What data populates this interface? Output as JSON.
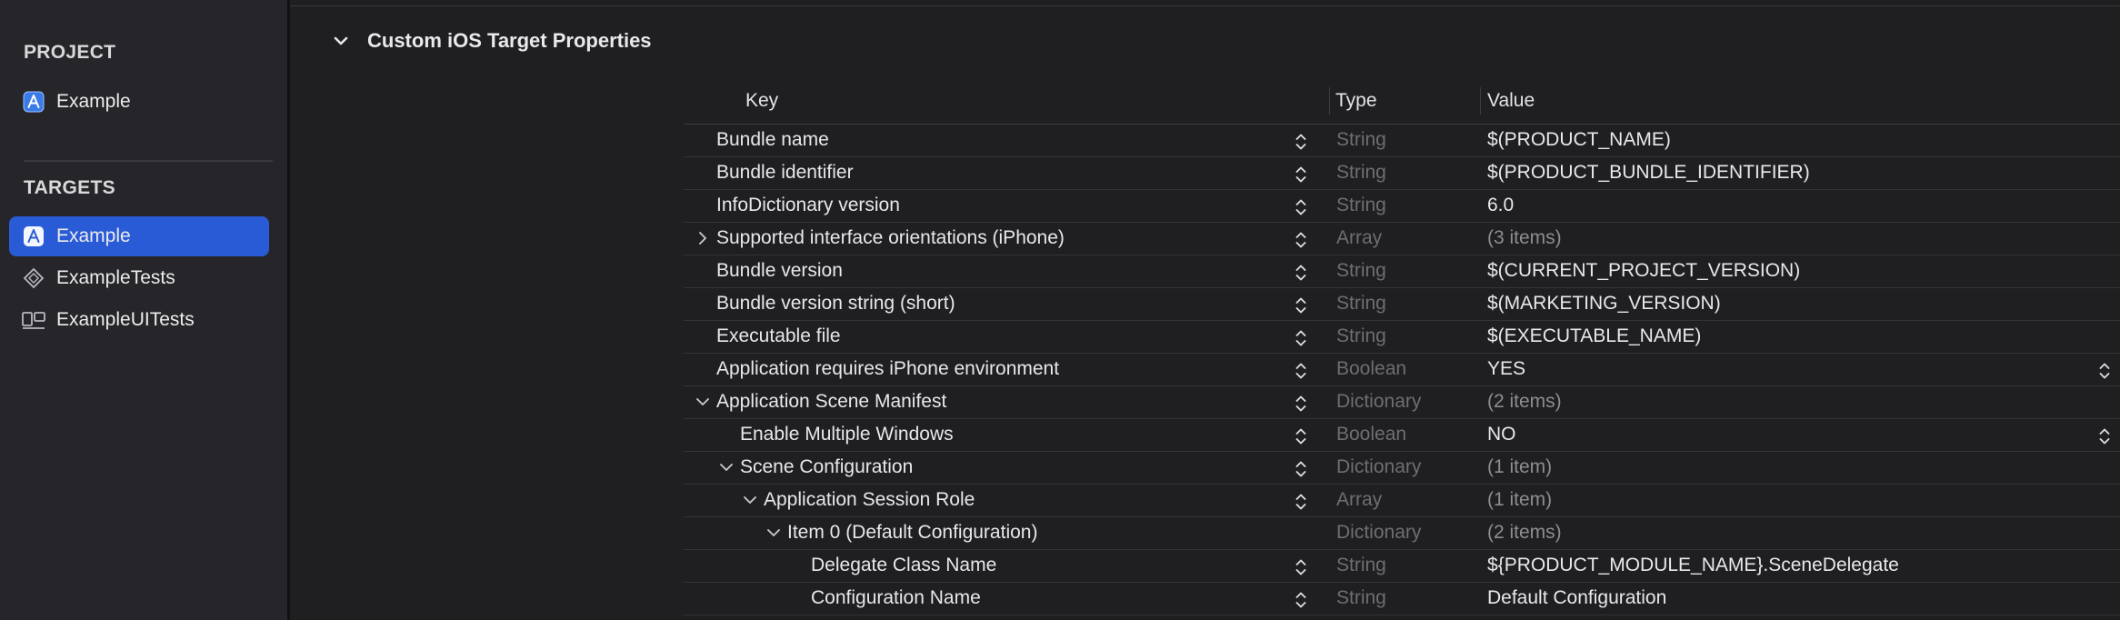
{
  "sidebar": {
    "project_title": "PROJECT",
    "project_items": [
      {
        "label": "Example",
        "icon": "app-target-icon"
      }
    ],
    "targets_title": "TARGETS",
    "target_items": [
      {
        "label": "Example",
        "icon": "app-target-icon",
        "selected": true
      },
      {
        "label": "ExampleTests",
        "icon": "unit-test-icon",
        "selected": false
      },
      {
        "label": "ExampleUITests",
        "icon": "ui-test-icon",
        "selected": false
      }
    ]
  },
  "section": {
    "title": "Custom iOS Target Properties",
    "expanded": true
  },
  "table": {
    "headers": {
      "key": "Key",
      "type": "Type",
      "value": "Value"
    },
    "rows": [
      {
        "key": "Bundle name",
        "type": "String",
        "value": "$(PRODUCT_NAME)",
        "level": 0,
        "disclosure": "none",
        "value_dim": false,
        "value_stepper": false
      },
      {
        "key": "Bundle identifier",
        "type": "String",
        "value": "$(PRODUCT_BUNDLE_IDENTIFIER)",
        "level": 0,
        "disclosure": "none",
        "value_dim": false,
        "value_stepper": false
      },
      {
        "key": "InfoDictionary version",
        "type": "String",
        "value": "6.0",
        "level": 0,
        "disclosure": "none",
        "value_dim": false,
        "value_stepper": false
      },
      {
        "key": "Supported interface orientations (iPhone)",
        "type": "Array",
        "value": "(3 items)",
        "level": 0,
        "disclosure": "collapsed",
        "value_dim": true,
        "value_stepper": false
      },
      {
        "key": "Bundle version",
        "type": "String",
        "value": "$(CURRENT_PROJECT_VERSION)",
        "level": 0,
        "disclosure": "none",
        "value_dim": false,
        "value_stepper": false
      },
      {
        "key": "Bundle version string (short)",
        "type": "String",
        "value": "$(MARKETING_VERSION)",
        "level": 0,
        "disclosure": "none",
        "value_dim": false,
        "value_stepper": false
      },
      {
        "key": "Executable file",
        "type": "String",
        "value": "$(EXECUTABLE_NAME)",
        "level": 0,
        "disclosure": "none",
        "value_dim": false,
        "value_stepper": false
      },
      {
        "key": "Application requires iPhone environment",
        "type": "Boolean",
        "value": "YES",
        "level": 0,
        "disclosure": "none",
        "value_dim": false,
        "value_stepper": true
      },
      {
        "key": "Application Scene Manifest",
        "type": "Dictionary",
        "value": "(2 items)",
        "level": 0,
        "disclosure": "expanded",
        "value_dim": true,
        "value_stepper": false
      },
      {
        "key": "Enable Multiple Windows",
        "type": "Boolean",
        "value": "NO",
        "level": 1,
        "disclosure": "none",
        "value_dim": false,
        "value_stepper": true
      },
      {
        "key": "Scene Configuration",
        "type": "Dictionary",
        "value": "(1 item)",
        "level": 1,
        "disclosure": "expanded",
        "value_dim": true,
        "value_stepper": false
      },
      {
        "key": "Application Session Role",
        "type": "Array",
        "value": "(1 item)",
        "level": 2,
        "disclosure": "expanded",
        "value_dim": true,
        "value_stepper": false
      },
      {
        "key": "Item 0 (Default Configuration)",
        "type": "Dictionary",
        "value": "(2 items)",
        "level": 3,
        "disclosure": "expanded",
        "value_dim": true,
        "value_stepper": false,
        "no_key_stepper": true
      },
      {
        "key": "Delegate Class Name",
        "type": "String",
        "value": "${PRODUCT_MODULE_NAME}.SceneDelegate",
        "level": 4,
        "disclosure": "none",
        "value_dim": false,
        "value_stepper": false
      },
      {
        "key": "Configuration Name",
        "type": "String",
        "value": "Default Configuration",
        "level": 4,
        "disclosure": "none",
        "value_dim": false,
        "value_stepper": false
      }
    ]
  }
}
